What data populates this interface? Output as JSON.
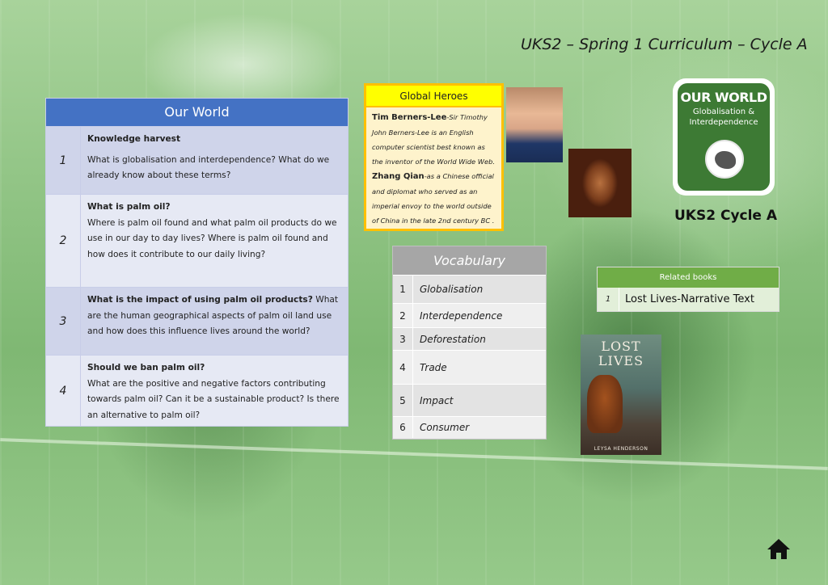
{
  "header": {
    "title": "UKS2 – Spring 1 Curriculum – Cycle A"
  },
  "our_world": {
    "heading": "Our World",
    "rows": [
      {
        "num": "1",
        "q": "Knowledge harvest",
        "body": "What is globalisation and interdependence? What do we already know about these terms?"
      },
      {
        "num": "2",
        "q": "What is palm oil?",
        "body": "Where is palm oil found and what palm oil products do we use in our day to day lives? Where is palm oil found and how does it contribute to our daily living?"
      },
      {
        "num": "3",
        "q": "What is the impact of using palm oil products?",
        "body": "What are the human geographical aspects of palm oil land use and how does this influence lives around the world?"
      },
      {
        "num": "4",
        "q": "Should we ban palm oil?",
        "body": "What are the positive and negative factors contributing towards palm oil? Can it be a sustainable product? Is there an alternative to palm oil?"
      }
    ]
  },
  "global_heroes": {
    "heading": "Global Heroes",
    "heroes": [
      {
        "name": "Tim Berners-Lee",
        "desc": "-Sir Timothy John Berners-Lee is an English computer scientist best known as the inventor of the World Wide Web."
      },
      {
        "name": "Zhang Qian",
        "desc": "-as a Chinese official and diplomat who served as an imperial envoy to the world outside of China in the late 2nd century BC ."
      }
    ]
  },
  "logo": {
    "title": "OUR WORLD",
    "subtitle": "Globalisation & Interdependence"
  },
  "cycle_label": "UKS2 Cycle A",
  "vocabulary": {
    "heading": "Vocabulary",
    "items": [
      {
        "num": "1",
        "word": "Globalisation"
      },
      {
        "num": "2",
        "word": "Interdependence"
      },
      {
        "num": "3",
        "word": "Deforestation"
      },
      {
        "num": "4",
        "word": "Trade"
      },
      {
        "num": "5",
        "word": "Impact"
      },
      {
        "num": "6",
        "word": "Consumer"
      }
    ]
  },
  "related_books": {
    "heading": "Related books",
    "items": [
      {
        "num": "1",
        "title": "Lost Lives-Narrative Text"
      }
    ]
  },
  "book_cover": {
    "title": "LOST LIVES",
    "author": "LEYSA HENDERSON"
  },
  "icons": {
    "home": "home-icon"
  },
  "colors": {
    "our_world_header": "#4472c4",
    "global_heroes_border": "#ffc000",
    "vocabulary_header": "#a6a6a6",
    "related_books_header": "#70ad47"
  }
}
